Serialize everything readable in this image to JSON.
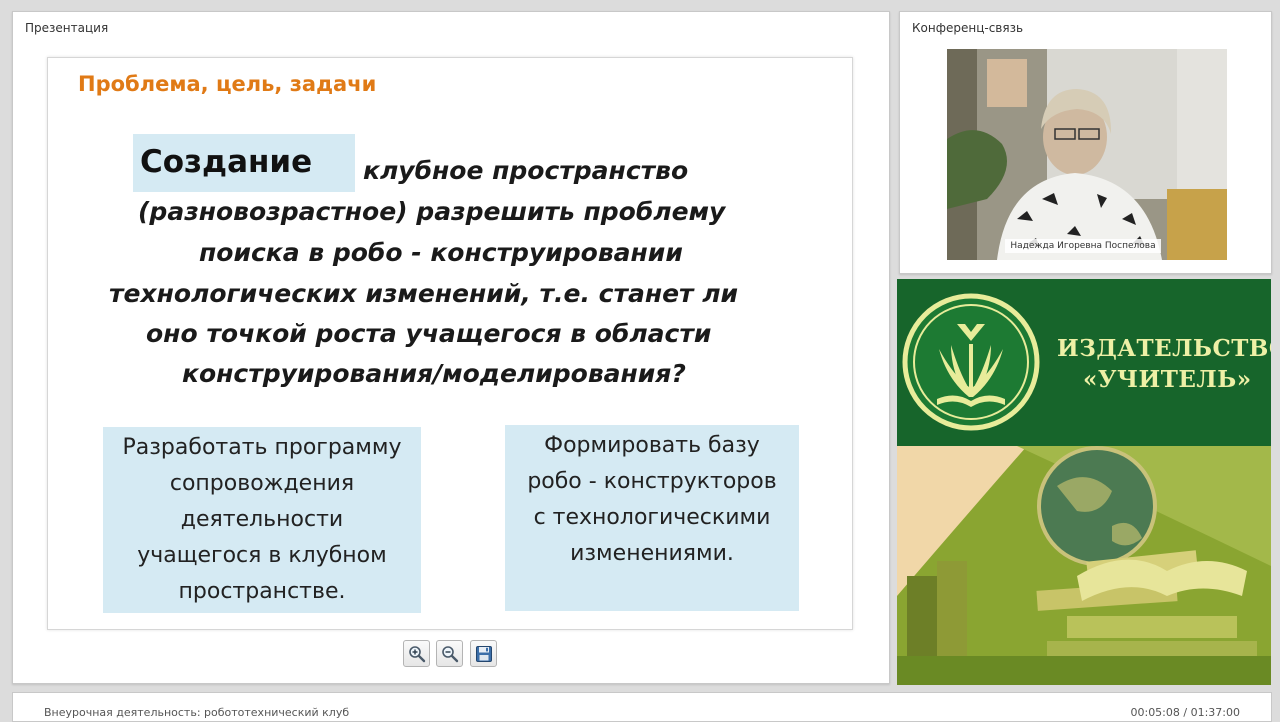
{
  "presentation_panel": {
    "title": "Презентация",
    "slide": {
      "heading": "Проблема, цель, задачи",
      "highlight_word": "Создание",
      "paragraph_lines": [
        "клубное пространство",
        "(разновозрастное) разрешить проблему",
        "поиска в робо - конструировании",
        "технологических изменений, т.е. станет ли",
        "оно точкой роста учащегося в области",
        "конструирования/моделирования?"
      ],
      "task_left_lines": [
        "Разработать программу",
        "сопровождения",
        "деятельности",
        "учащегося в клубном",
        "пространстве."
      ],
      "task_right_lines": [
        "Формировать базу",
        "робо - конструкторов",
        "с технологическими",
        "изменениями."
      ]
    },
    "toolbar": {
      "zoom_in_icon": "zoom-in-icon",
      "zoom_out_icon": "zoom-out-icon",
      "save_icon": "save-icon"
    }
  },
  "conference_panel": {
    "title": "Конференц-связь",
    "speaker_name": "Надежда Игоревна Поспелова"
  },
  "banner": {
    "publisher_line1": "ИЗДАТЕЛЬСТВО",
    "publisher_line2": "«УЧИТЕЛЬ»",
    "colors": {
      "top": "#17652b",
      "text": "#eef0a6",
      "bottom": "#7f9a2c"
    }
  },
  "bottom_bar": {
    "course_title": "Внеурочная деятельность: робототехнический клуб",
    "time": "00:05:08 / 01:37:00"
  },
  "colors": {
    "heading_accent": "#e07a16",
    "highlight": "#d5eaf3"
  }
}
